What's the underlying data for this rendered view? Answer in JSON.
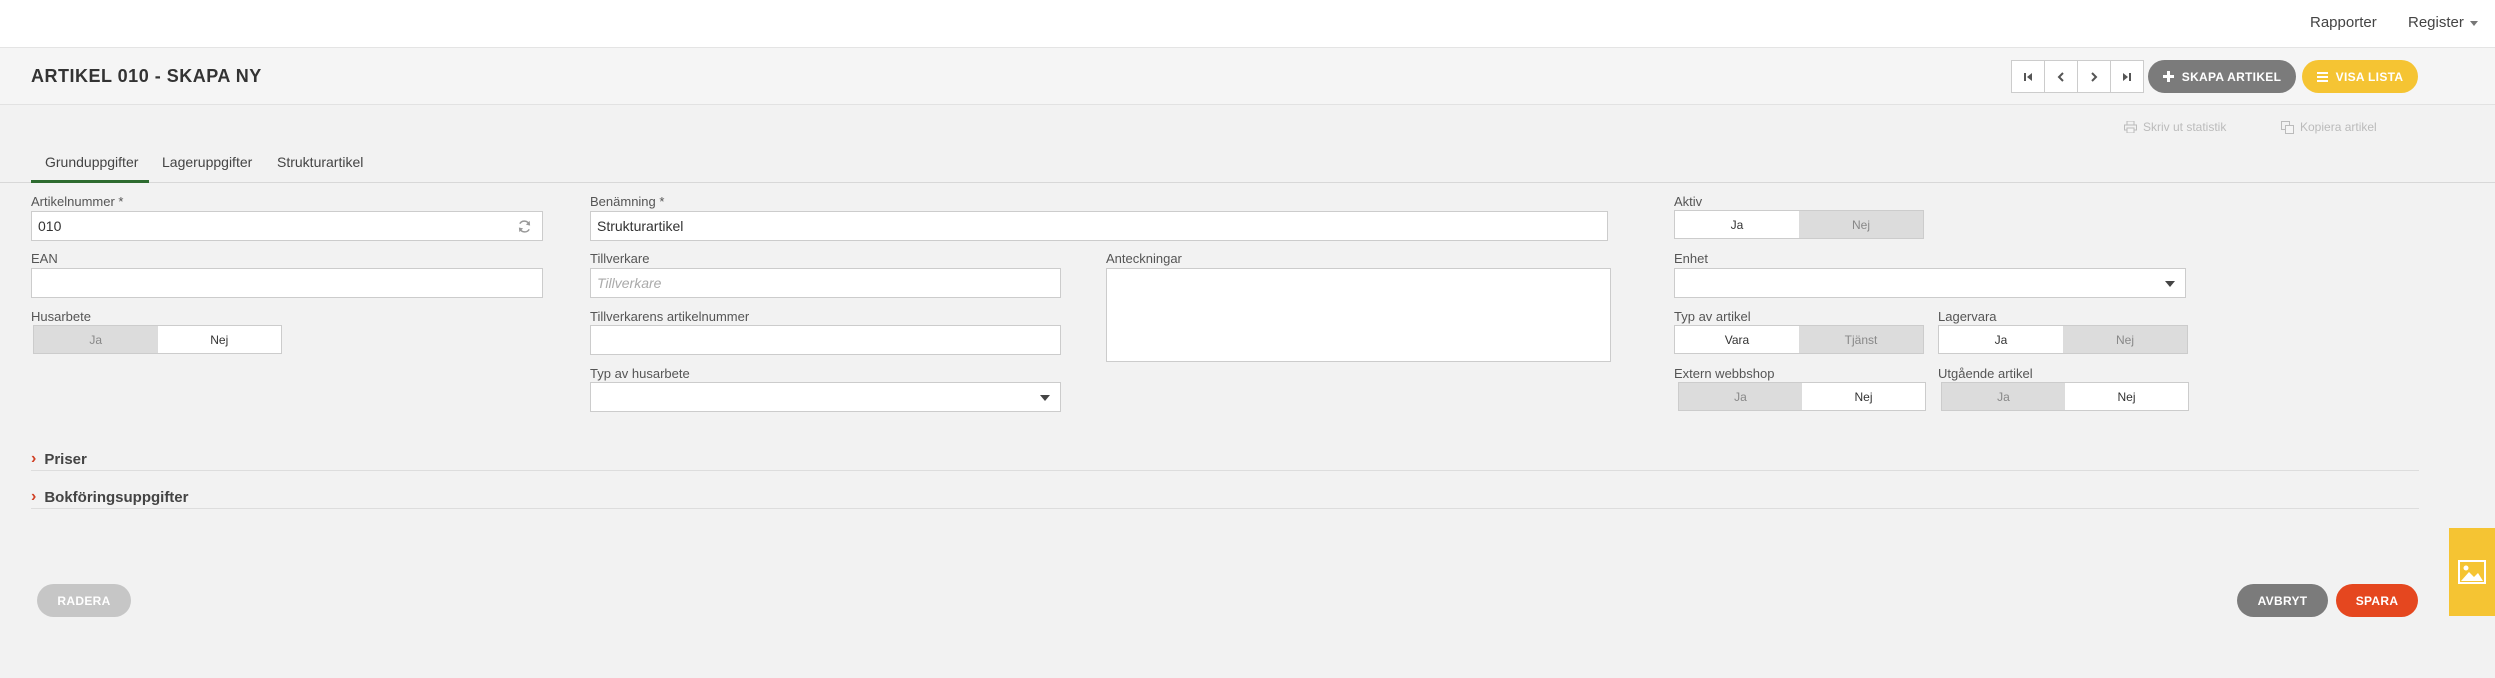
{
  "topnav": {
    "reports": "Rapporter",
    "register": "Register"
  },
  "header": {
    "title": "ARTIKEL 010 - SKAPA NY",
    "create_article": "SKAPA ARTIKEL",
    "show_list": "VISA LISTA"
  },
  "tools": {
    "print_stats": "Skriv ut statistik",
    "copy_article": "Kopiera artikel"
  },
  "tabs": [
    "Grunduppgifter",
    "Lageruppgifter",
    "Strukturartikel"
  ],
  "form": {
    "article_number": {
      "label": "Artikelnummer *",
      "value": "010"
    },
    "ean": {
      "label": "EAN",
      "value": ""
    },
    "husarbete": {
      "label": "Husarbete",
      "yes": "Ja",
      "no": "Nej",
      "selected": "Nej"
    },
    "name": {
      "label": "Benämning *",
      "value": "Strukturartikel"
    },
    "manufacturer": {
      "label": "Tillverkare",
      "placeholder": "Tillverkare"
    },
    "manufacturer_article_number": {
      "label": "Tillverkarens artikelnummer",
      "value": ""
    },
    "husarbete_type": {
      "label": "Typ av husarbete",
      "value": ""
    },
    "notes": {
      "label": "Anteckningar",
      "value": ""
    },
    "active": {
      "label": "Aktiv",
      "yes": "Ja",
      "no": "Nej",
      "selected": "Ja"
    },
    "unit": {
      "label": "Enhet",
      "value": ""
    },
    "article_type": {
      "label": "Typ av artikel",
      "goods": "Vara",
      "service": "Tjänst",
      "selected": "Vara"
    },
    "stock_item": {
      "label": "Lagervara",
      "yes": "Ja",
      "no": "Nej",
      "selected": "Ja"
    },
    "external_webshop": {
      "label": "Extern webbshop",
      "yes": "Ja",
      "no": "Nej",
      "selected": "Nej"
    },
    "outgoing_article": {
      "label": "Utgående artikel",
      "yes": "Ja",
      "no": "Nej",
      "selected": "Nej"
    }
  },
  "sections": {
    "prices": "Priser",
    "accounting": "Bokföringsuppgifter"
  },
  "footer": {
    "delete": "RADERA",
    "cancel": "AVBRYT",
    "save": "SPARA"
  },
  "colors": {
    "accent_yellow": "#f5c433",
    "gray_pill": "#7b7b7b",
    "save_red": "#e5471f",
    "tab_green": "#2d6b2f",
    "chevron_red": "#d04025"
  },
  "icons": [
    "refresh-icon",
    "first-page-icon",
    "prev-icon",
    "next-icon",
    "last-page-icon",
    "plus-icon",
    "list-icon",
    "print-icon",
    "copy-icon",
    "chevron-right-icon",
    "image-icon"
  ]
}
